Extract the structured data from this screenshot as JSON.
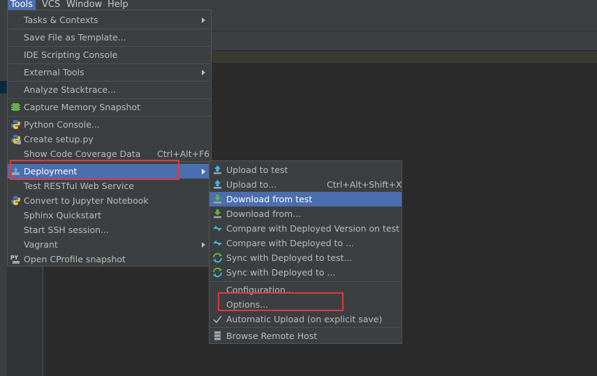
{
  "menubar": {
    "items": [
      "Tools",
      "VCS",
      "Window",
      "Help"
    ]
  },
  "tools_menu": {
    "items": [
      {
        "label": "Tasks & Contexts",
        "submenu": true
      },
      {
        "label": "Save File as Template..."
      },
      {
        "label": "IDE Scripting Console"
      },
      {
        "label": "External Tools",
        "submenu": true
      },
      {
        "label": "Analyze Stacktrace..."
      },
      {
        "label": "Capture Memory Snapshot",
        "icon": "memory-snapshot-icon"
      },
      {
        "label": "Python Console...",
        "icon": "python-icon"
      },
      {
        "label": "Create setup.py",
        "icon": "python-setup-icon"
      },
      {
        "label": "Show Code Coverage Data",
        "shortcut": "Ctrl+Alt+F6"
      },
      {
        "label": "Deployment",
        "submenu": true,
        "icon": "deployment-icon",
        "highlighted": true
      },
      {
        "label": "Test RESTful Web Service"
      },
      {
        "label": "Convert to Jupyter Notebook",
        "icon": "jupyter-icon"
      },
      {
        "label": "Sphinx Quickstart"
      },
      {
        "label": "Start SSH session..."
      },
      {
        "label": "Vagrant",
        "submenu": true
      },
      {
        "label": "Open CProfile snapshot",
        "icon": "cprofile-icon"
      }
    ]
  },
  "deployment_menu": {
    "items": [
      {
        "label": "Upload to test",
        "icon": "upload-icon"
      },
      {
        "label": "Upload to...",
        "shortcut": "Ctrl+Alt+Shift+X",
        "icon": "upload-icon"
      },
      {
        "label": "Download from test",
        "icon": "download-icon",
        "highlighted": true
      },
      {
        "label": "Download from...",
        "icon": "download-icon"
      },
      {
        "label": "Compare with Deployed Version on test",
        "icon": "compare-icon"
      },
      {
        "label": "Compare with Deployed to ...",
        "icon": "compare-icon"
      },
      {
        "label": "Sync with Deployed to test...",
        "icon": "sync-icon"
      },
      {
        "label": "Sync with Deployed to ...",
        "icon": "sync-icon"
      },
      {
        "label": "Configuration..."
      },
      {
        "label": "Options..."
      },
      {
        "label": "Automatic Upload (on explicit save)",
        "icon": "checkmark-icon"
      },
      {
        "label": "Browse Remote Host",
        "icon": "remote-host-icon"
      }
    ]
  },
  "colors": {
    "menu_bg": "#3c3f41",
    "highlight": "#4b6eaf",
    "annotation_red": "#e0393e",
    "text": "#bbbbbb"
  }
}
